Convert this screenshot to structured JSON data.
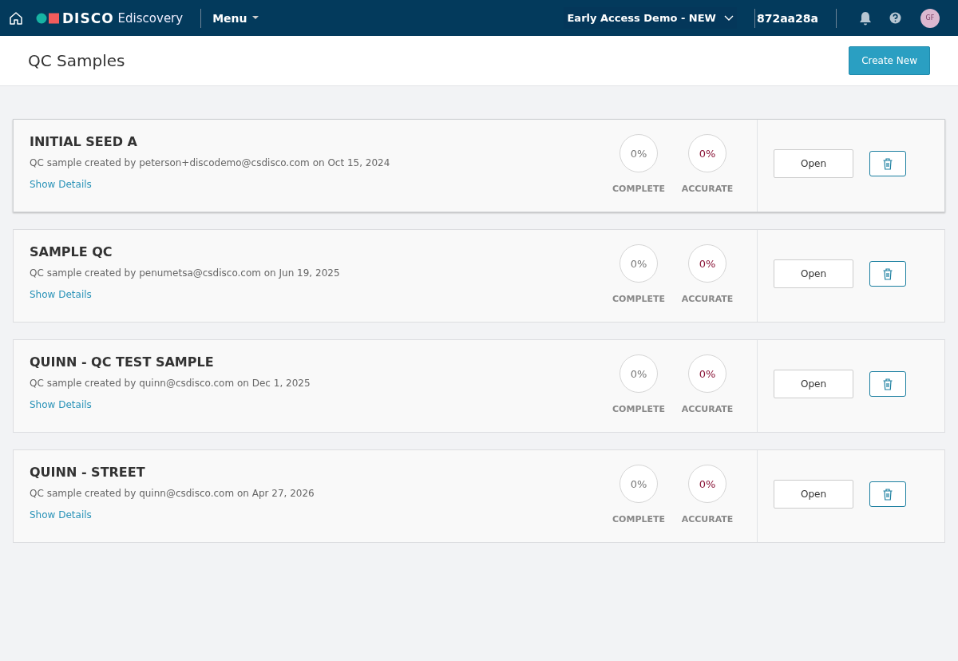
{
  "navbar": {
    "logo_text": "DISCO",
    "product": "Ediscovery",
    "menu": "Menu",
    "workspace": "Early Access Demo - NEW",
    "code": "872aa28a",
    "avatar": "GF"
  },
  "page": {
    "title": "QC Samples",
    "create_button": "Create New"
  },
  "samples": [
    {
      "title": "INITIAL SEED A",
      "description": "QC sample created by peterson+discodemo@csdisco.com on Oct 15, 2024",
      "details_link": "Show Details",
      "selected": true,
      "metrics": [
        {
          "kind": "complete",
          "value": "0%",
          "label": "COMPLETE"
        },
        {
          "kind": "accurate",
          "value": "0%",
          "label": "ACCURATE"
        }
      ],
      "open_button": "Open"
    },
    {
      "title": "SAMPLE QC",
      "description": "QC sample created by penumetsa@csdisco.com on Jun 19, 2025",
      "details_link": "Show Details",
      "selected": false,
      "metrics": [
        {
          "kind": "complete",
          "value": "0%",
          "label": "COMPLETE"
        },
        {
          "kind": "accurate",
          "value": "0%",
          "label": "ACCURATE"
        }
      ],
      "open_button": "Open"
    },
    {
      "title": "QUINN - QC TEST SAMPLE",
      "description": "QC sample created by quinn@csdisco.com on Dec 1, 2025",
      "details_link": "Show Details",
      "selected": false,
      "metrics": [
        {
          "kind": "complete",
          "value": "0%",
          "label": "COMPLETE"
        },
        {
          "kind": "accurate",
          "value": "0%",
          "label": "ACCURATE"
        }
      ],
      "open_button": "Open"
    },
    {
      "title": "QUINN - STREET",
      "description": "QC sample created by quinn@csdisco.com on Apr 27, 2026",
      "details_link": "Show Details",
      "selected": false,
      "metrics": [
        {
          "kind": "complete",
          "value": "0%",
          "label": "COMPLETE"
        },
        {
          "kind": "accurate",
          "value": "0%",
          "label": "ACCURATE"
        }
      ],
      "open_button": "Open"
    }
  ]
}
